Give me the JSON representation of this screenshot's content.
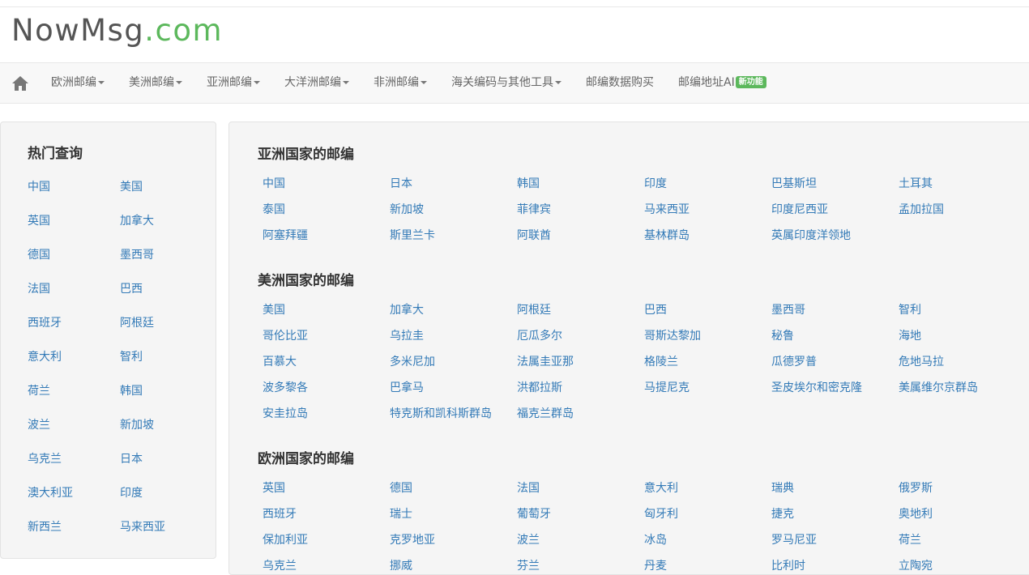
{
  "logo": {
    "part1": "NowMsg",
    "part2": ".com"
  },
  "nav": {
    "items": [
      {
        "label": "欧洲邮编",
        "dropdown": true
      },
      {
        "label": "美洲邮编",
        "dropdown": true
      },
      {
        "label": "亚洲邮编",
        "dropdown": true
      },
      {
        "label": "大洋洲邮编",
        "dropdown": true
      },
      {
        "label": "非洲邮编",
        "dropdown": true
      },
      {
        "label": "海关编码与其他工具",
        "dropdown": true
      },
      {
        "label": "邮编数据购买",
        "dropdown": false
      },
      {
        "label": "邮编地址AI",
        "dropdown": false,
        "badge": "新功能"
      }
    ]
  },
  "sidebar": {
    "title": "热门查询",
    "items": [
      "中国",
      "美国",
      "英国",
      "加拿大",
      "德国",
      "墨西哥",
      "法国",
      "巴西",
      "西班牙",
      "阿根廷",
      "意大利",
      "智利",
      "荷兰",
      "韩国",
      "波兰",
      "新加坡",
      "乌克兰",
      "日本",
      "澳大利亚",
      "印度",
      "新西兰",
      "马来西亚"
    ]
  },
  "sections": [
    {
      "title": "亚洲国家的邮编",
      "countries": [
        "中国",
        "日本",
        "韩国",
        "印度",
        "巴基斯坦",
        "土耳其",
        "泰国",
        "新加坡",
        "菲律宾",
        "马来西亚",
        "印度尼西亚",
        "孟加拉国",
        "阿塞拜疆",
        "斯里兰卡",
        "阿联酋",
        "基林群岛",
        "英属印度洋领地"
      ]
    },
    {
      "title": "美洲国家的邮编",
      "countries": [
        "美国",
        "加拿大",
        "阿根廷",
        "巴西",
        "墨西哥",
        "智利",
        "哥伦比亚",
        "乌拉圭",
        "厄瓜多尔",
        "哥斯达黎加",
        "秘鲁",
        "海地",
        "百慕大",
        "多米尼加",
        "法属圭亚那",
        "格陵兰",
        "瓜德罗普",
        "危地马拉",
        "波多黎各",
        "巴拿马",
        "洪都拉斯",
        "马提尼克",
        "圣皮埃尔和密克隆",
        "美属维尔京群岛",
        "安圭拉岛",
        "特克斯和凯科斯群岛",
        "福克兰群岛"
      ]
    },
    {
      "title": "欧洲国家的邮编",
      "countries": [
        "英国",
        "德国",
        "法国",
        "意大利",
        "瑞典",
        "俄罗斯",
        "西班牙",
        "瑞士",
        "葡萄牙",
        "匈牙利",
        "捷克",
        "奥地利",
        "保加利亚",
        "克罗地亚",
        "波兰",
        "冰岛",
        "罗马尼亚",
        "荷兰",
        "乌克兰",
        "挪威",
        "芬兰",
        "丹麦",
        "比利时",
        "立陶宛"
      ]
    }
  ],
  "colors": {
    "brand_green": "#5cb85c",
    "link_blue": "#337ab7"
  }
}
